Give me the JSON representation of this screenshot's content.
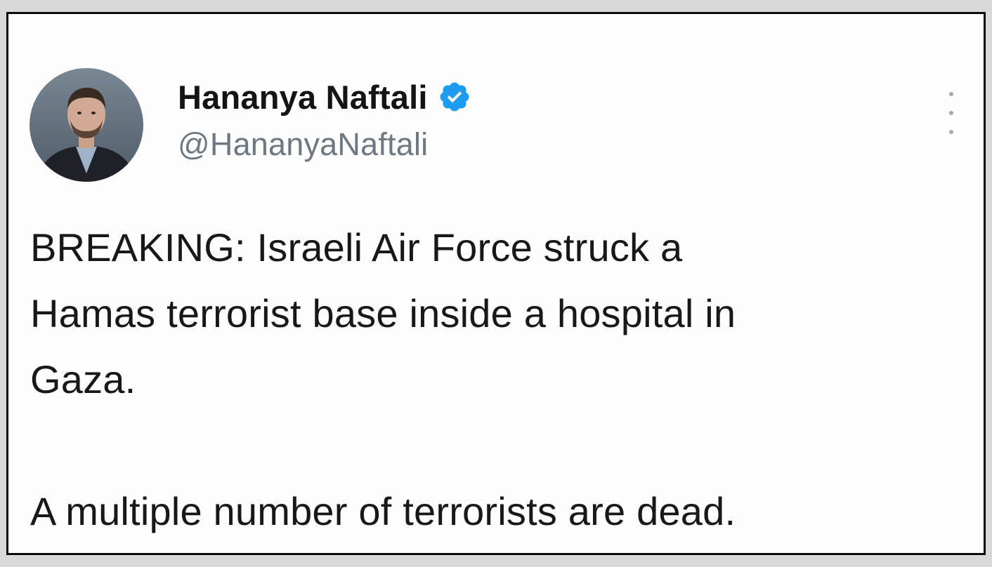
{
  "tweet": {
    "author": {
      "display_name": "Hananya Naftali",
      "handle": "@HananyaNaftali",
      "verified": true,
      "avatar_icon": "profile-photo"
    },
    "menu_icon": "more-options-icon",
    "text_lines": [
      "BREAKING: Israeli Air Force struck a",
      "Hamas terrorist base inside a hospital in",
      "Gaza."
    ],
    "second_paragraph": "A multiple number of terrorists are dead."
  },
  "colors": {
    "verified_badge": "#1d9bf0",
    "handle_text": "#6d7883",
    "frame_border": "#0a0a0a"
  }
}
